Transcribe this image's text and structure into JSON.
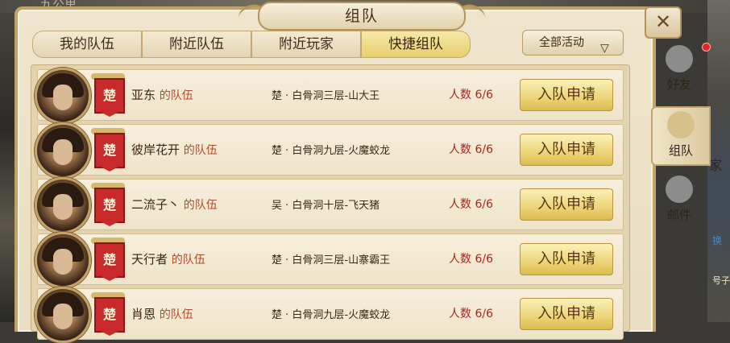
{
  "background": {
    "top_text": "九公里",
    "right_text_a": "家",
    "right_text_b": "换",
    "right_text_c": "号子"
  },
  "panel": {
    "title": "组队",
    "close_symbol": "✕"
  },
  "tabs": [
    {
      "label": "我的队伍",
      "active": false
    },
    {
      "label": "附近队伍",
      "active": false
    },
    {
      "label": "附近玩家",
      "active": false
    },
    {
      "label": "快捷组队",
      "active": true
    }
  ],
  "filter": {
    "label": "全部活动",
    "arrow": "▽"
  },
  "teams": [
    {
      "leader": "亚东",
      "suffix": "的队伍",
      "faction": "楚",
      "location": "楚 · 白骨洞三层-山大王",
      "count": "人数  6/6",
      "button": "入队申请"
    },
    {
      "leader": "彼岸花开",
      "suffix": "的队伍",
      "faction": "楚",
      "location": "楚 · 白骨洞九层-火魔蛟龙",
      "count": "人数  6/6",
      "button": "入队申请"
    },
    {
      "leader": "二流子丶",
      "suffix": "的队伍",
      "faction": "楚",
      "location": "吴 · 白骨洞十层-飞天猪",
      "count": "人数  6/6",
      "button": "入队申请"
    },
    {
      "leader": "天行者",
      "suffix": "的队伍",
      "faction": "楚",
      "location": "楚 · 白骨洞三层-山寨霸王",
      "count": "人数  6/6",
      "button": "入队申请"
    },
    {
      "leader": "肖恩",
      "suffix": "的队伍",
      "faction": "楚",
      "location": "楚 · 白骨洞九层-火魔蛟龙",
      "count": "人数  6/6",
      "button": "入队申请"
    }
  ],
  "side_tabs": [
    {
      "label": "好友",
      "icon": "friends-icon",
      "active": false
    },
    {
      "label": "组队",
      "icon": "team-icon",
      "active": true
    },
    {
      "label": "邮件",
      "icon": "mail-dove-icon",
      "active": false
    }
  ]
}
